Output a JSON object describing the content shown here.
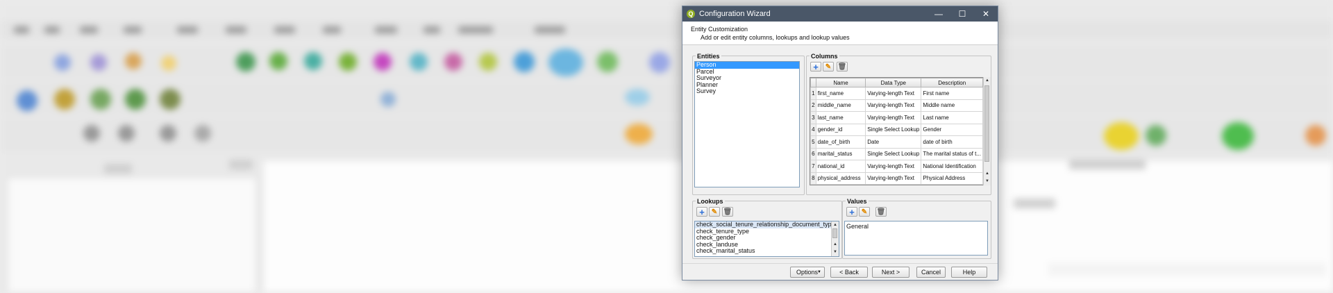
{
  "dialog": {
    "title": "Configuration Wizard",
    "app_icon_letter": "Q",
    "window_controls": {
      "minimize": "—",
      "maximize": "☐",
      "close": "✕"
    }
  },
  "header": {
    "title": "Entity Customization",
    "subtitle": "Add or edit entity columns, lookups and lookup values"
  },
  "entities": {
    "label": "Entities",
    "items": [
      "Person",
      "Parcel",
      "Surveyor",
      "Planner",
      "Survey"
    ],
    "selected": "Person"
  },
  "columns": {
    "label": "Columns",
    "headers": [
      "Name",
      "Data Type",
      "Description"
    ],
    "rows": [
      {
        "num": "1",
        "name": "first_name",
        "type": "Varying-length Text",
        "desc": "First name"
      },
      {
        "num": "2",
        "name": "middle_name",
        "type": "Varying-length Text",
        "desc": "Middle name"
      },
      {
        "num": "3",
        "name": "last_name",
        "type": "Varying-length Text",
        "desc": "Last name"
      },
      {
        "num": "4",
        "name": "gender_id",
        "type": "Single Select Lookup",
        "desc": "Gender"
      },
      {
        "num": "5",
        "name": "date_of_birth",
        "type": "Date",
        "desc": "date of birth"
      },
      {
        "num": "6",
        "name": "marital_status",
        "type": "Single Select Lookup",
        "desc": "The marital status of t..."
      },
      {
        "num": "7",
        "name": "national_id",
        "type": "Varying-length Text",
        "desc": "National Identification"
      },
      {
        "num": "8",
        "name": "physical_address",
        "type": "Varying-length Text",
        "desc": "Physical Address"
      }
    ]
  },
  "lookups": {
    "label": "Lookups",
    "items": [
      "check_social_tenure_relationship_document_type",
      "check_tenure_type",
      "check_gender",
      "check_landuse",
      "check_marital_status"
    ],
    "selected": "check_social_tenure_relationship_document_type"
  },
  "values": {
    "label": "Values",
    "items": [
      "General"
    ]
  },
  "toolbar_icons": {
    "add": "+",
    "edit": "✎",
    "delete": "🗑"
  },
  "footer": {
    "options": "Options",
    "back": "< Back",
    "next": "Next >",
    "cancel": "Cancel",
    "help": "Help"
  },
  "colors": {
    "titlebar": "#4a5768",
    "selection": "#3399ff",
    "app_icon": "#93b023"
  }
}
